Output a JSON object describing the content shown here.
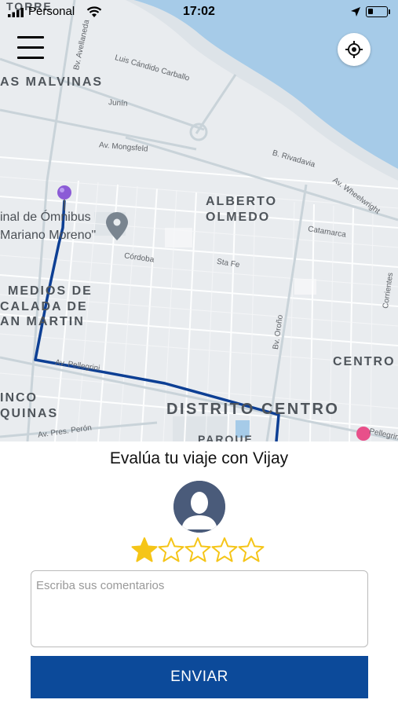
{
  "status_bar": {
    "carrier": "Personal",
    "time": "17:02",
    "signal_icon": "signal-bars-icon",
    "wifi_icon": "wifi-icon",
    "location_icon": "location-arrow-icon",
    "battery_icon": "battery-icon",
    "battery_level": 0.25
  },
  "map": {
    "district_labels": {
      "torre": "TORRE",
      "malvinas": "AS MALVINAS",
      "alberto_olmedo_1": "ALBERTO",
      "alberto_olmedo_2": "OLMEDO",
      "remedios_1": "MEDIOS DE",
      "remedios_2": "CALADA DE",
      "remedios_3": "AN MARTIN",
      "centro": "CENTRO",
      "distrito_centro": "DISTRITO CENTRO",
      "cinco_1": "INCO",
      "cinco_2": "QUINAS",
      "parque": "PARQUE"
    },
    "poi": {
      "terminal_1": "inal de Ómnibus",
      "terminal_2": "Mariano Moreno\""
    },
    "streets": {
      "luis_candido": "Luis Cándido Carballo",
      "avellaneda": "Bv. Avellaneda",
      "junin": "Junín",
      "mongsfeld": "Av. Mongsfeld",
      "rivadavia": "B. Rivadavia",
      "wheelwright": "Av. Wheelwright",
      "catamarca": "Catamarca",
      "cordoba": "Córdoba",
      "santa_fe": "Sta Fe",
      "pellegrini": "Av. Pellegrini",
      "pellegrini_2": "Pellegrini",
      "oroño": "Bv. Oroño",
      "corrientes": "Corrientes",
      "peron": "Av. Pres. Perón"
    },
    "menu_icon": "hamburger-menu-icon",
    "locate_icon": "crosshair-locate-icon",
    "route_color": "#0d3f94",
    "water_color": "#a6cbe8"
  },
  "rating": {
    "title": "Evalúa tu viaje con Vijay",
    "avatar_icon": "user-avatar-icon",
    "stars_selected": 1,
    "stars_total": 5,
    "star_color": "#f5c518",
    "comment_placeholder": "Escriba sus comentarios",
    "comment_value": "",
    "submit_label": "ENVIAR",
    "submit_color": "#0c4a9a"
  }
}
